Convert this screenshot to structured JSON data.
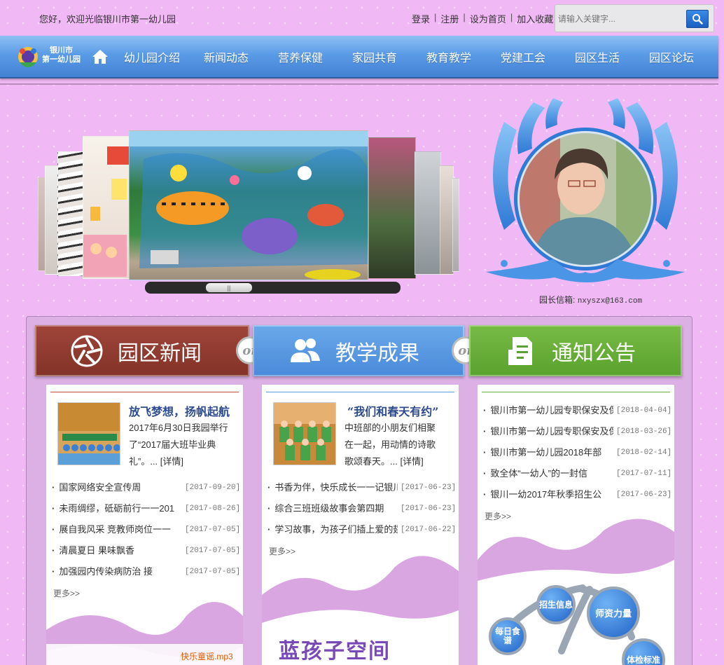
{
  "header": {
    "welcome": "您好，欢迎光临银川市第一幼儿园",
    "links": [
      "登录",
      "注册",
      "设为首页",
      "加入收藏"
    ],
    "search_placeholder": "请输入关键字..."
  },
  "logo": {
    "line1": "银川市",
    "line2": "第一幼儿园"
  },
  "nav": [
    "幼儿园介绍",
    "新闻动态",
    "营养保健",
    "家园共育",
    "教育教学",
    "党建工会",
    "园区生活",
    "园区论坛"
  ],
  "principal": {
    "label": "园长信箱:",
    "email": "nxyszx@163.com"
  },
  "tabs": {
    "news": "园区新闻",
    "teaching": "教学成果",
    "notice": "通知公告",
    "or": "or"
  },
  "news": {
    "feature": {
      "title": "放飞梦想，扬帆起航",
      "desc": "2017年6月30日我园举行了“2017届大班毕业典礼”。...",
      "more": "[详情]"
    },
    "items": [
      {
        "title": "国家网络安全宣传周",
        "date": "[2017-09-20]"
      },
      {
        "title": "未雨绸缪，砥砺前行一一201",
        "date": "[2017-08-26]"
      },
      {
        "title": "展自我风采 竞教师岗位一一",
        "date": "[2017-07-05]"
      },
      {
        "title": "清晨夏日 果味飘香",
        "date": "[2017-07-05]"
      },
      {
        "title": "加强园内传染病防治 接",
        "date": "[2017-07-05]"
      }
    ],
    "more": "更多>>",
    "music": "快乐童谣.mp3"
  },
  "teaching": {
    "feature": {
      "title": "“我们和春天有约”",
      "desc": "中班部的小朋友们相聚在一起，用动情的诗歌歌颂春天。...",
      "more": "[详情]"
    },
    "items": [
      {
        "title": "书香为伴，快乐成长一一记银川",
        "date": "[2017-06-23]"
      },
      {
        "title": "综合三班班级故事会第四期",
        "date": "[2017-06-23]"
      },
      {
        "title": "学习故事，为孩子们插上爱的翅",
        "date": "[2017-06-22]"
      }
    ],
    "more": "更多>>",
    "kids_space": "蓝孩子空间"
  },
  "notice": {
    "items": [
      {
        "title": "银川市第一幼儿园专职保安及保",
        "date": "[2018-04-04]"
      },
      {
        "title": "银川市第一幼儿园专职保安及保",
        "date": "[2018-03-26]"
      },
      {
        "title": "银川市第一幼儿园2018年部",
        "date": "[2018-02-14]"
      },
      {
        "title": "致全体“一幼人”的一封信",
        "date": "[2017-07-11]"
      },
      {
        "title": "银川一幼2017年秋季招生公",
        "date": "[2017-06-23]"
      }
    ],
    "more": "更多>>",
    "bubbles": [
      "招生信息",
      "师资力量",
      "每日食谱",
      "体检标准"
    ]
  },
  "colors": {
    "background": "#f0b8f4",
    "nav": "#5a9be6",
    "news_tab": "#8f3a2f",
    "teaching_tab": "#5a9ae2",
    "notice_tab": "#66ae36",
    "feature_title": "#2c4a8c"
  }
}
